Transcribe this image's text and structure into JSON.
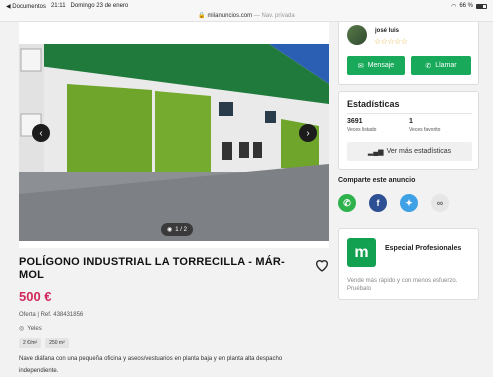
{
  "status": {
    "back_app": "◀ Documentos",
    "time": "21:11",
    "date": "Domingo 23 de enero",
    "battery": "66 %",
    "battery_level": 0.66
  },
  "url": {
    "host": "milanuncios.com",
    "mode": "— Nav. privada"
  },
  "gallery": {
    "counter": "1 / 2"
  },
  "listing": {
    "title": "POLÍGONO INDUSTRIAL LA TORRECILLA - MÁR-MOL",
    "price": "500 €",
    "meta": "Oferta | Ref. 438431856",
    "location": "Yeles",
    "tags": [
      "2 €/m²",
      "250 m²"
    ],
    "description": "Nave diáfana con una pequeña oficina y aseos/vestuarios en planta baja y en planta alta despacho independiente."
  },
  "seller": {
    "name": "josé luis",
    "stars": "☆☆☆☆☆",
    "message_label": "Mensaje",
    "call_label": "Llamar"
  },
  "stats": {
    "title": "Estadísticas",
    "views": "3691",
    "views_label": "Veces listado",
    "favs": "1",
    "favs_label": "Veces favorito",
    "more_label": "Ver más estadísticas"
  },
  "share": {
    "title": "Comparte este anuncio"
  },
  "pro": {
    "logo": "m",
    "title": "Especial Profesionales",
    "text": "Vende más rápido y con menos esfuerzo. Pruébalo"
  },
  "colors": {
    "price": "#d1285c",
    "green": "#18a95a",
    "facebook": "#2d4f93",
    "twitter": "#3ea1e6",
    "whatsapp": "#2fb24c"
  },
  "icons": [
    "wifi-icon",
    "battery-icon",
    "lock-icon",
    "chevron-left-icon",
    "chevron-right-icon",
    "camera-icon",
    "heart-icon",
    "location-pin-icon",
    "mail-icon",
    "phone-icon",
    "bar-chart-icon",
    "whatsapp-icon",
    "facebook-icon",
    "twitter-icon",
    "link-icon"
  ]
}
